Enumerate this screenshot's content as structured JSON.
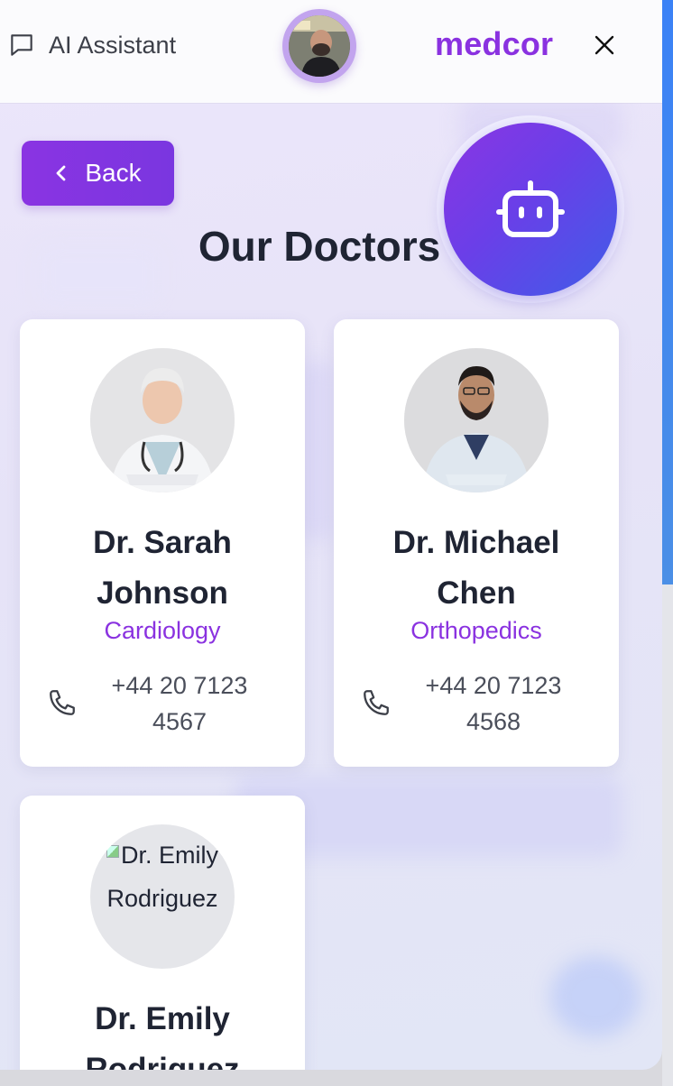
{
  "header": {
    "assistant_label": "AI Assistant",
    "brand": "medcor"
  },
  "back_label": "Back",
  "page_title": "Our Doctors",
  "doctors": [
    {
      "name": "Dr. Sarah Johnson",
      "specialty": "Cardiology",
      "phone": "+44 20 7123 4567"
    },
    {
      "name": "Dr. Michael Chen",
      "specialty": "Orthopedics",
      "phone": "+44 20 7123 4568"
    },
    {
      "name": "Dr. Emily Rodriguez",
      "photo_alt": "Dr. Emily Rodriguez"
    }
  ],
  "icons": {
    "assistant": "chat-bubble-icon",
    "close": "close-icon",
    "back": "chevron-left-icon",
    "bot": "robot-icon",
    "phone": "phone-icon"
  },
  "colors": {
    "brand": "#8a32e0",
    "back_button": "#8a34e2",
    "bot_gradient_start": "#8b35e3",
    "bot_gradient_end": "#3f5de8",
    "title": "#1f2433"
  }
}
